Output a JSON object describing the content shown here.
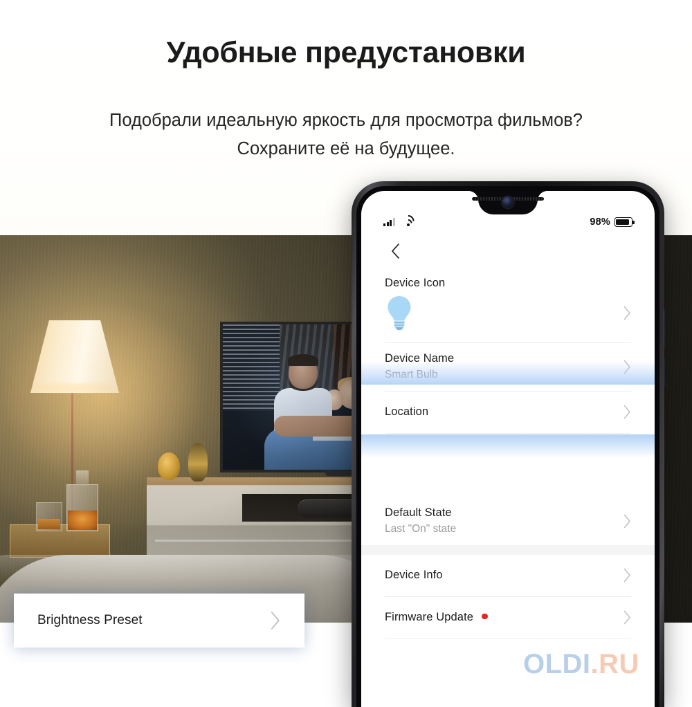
{
  "header": {
    "title": "Удобные предустановки",
    "subtitle": "Подобрали идеальную яркость для просмотра фильмов? Сохраните её на будущее."
  },
  "phone": {
    "status_bar": {
      "signal_icon": "signal-bars-icon",
      "wifi_icon": "wifi-icon",
      "battery_percent": "98%",
      "battery_icon": "battery-icon"
    },
    "nav": {
      "back_icon": "chevron-left-icon"
    },
    "settings_list": [
      {
        "id": "device-icon",
        "label": "Device Icon",
        "sub": "",
        "icon": "light-bulb-icon",
        "chevron": "chevron-right-icon",
        "badge": false
      },
      {
        "id": "device-name",
        "label": "Device Name",
        "sub": "Smart Bulb",
        "icon": "",
        "chevron": "chevron-right-icon",
        "badge": false
      },
      {
        "id": "location",
        "label": "Location",
        "sub": "",
        "icon": "",
        "chevron": "chevron-right-icon",
        "badge": false
      },
      {
        "id": "default-state",
        "label": "Default State",
        "sub": "Last \"On\" state",
        "icon": "",
        "chevron": "chevron-right-icon",
        "badge": false
      },
      {
        "id": "device-info",
        "label": "Device Info",
        "sub": "",
        "icon": "",
        "chevron": "chevron-right-icon",
        "badge": false
      },
      {
        "id": "firmware-update",
        "label": "Firmware Update",
        "sub": "",
        "icon": "",
        "chevron": "chevron-right-icon",
        "badge": true
      }
    ],
    "highlighted_row": {
      "label": "Brightness Preset",
      "chevron": "chevron-right-icon"
    }
  },
  "watermark": {
    "part_a": "OLDI",
    "part_b": ".RU",
    "color_a": "#b8cfe8",
    "color_b": "#f6cbb3"
  },
  "colors": {
    "accent_blue": "#aacdf5",
    "badge_red": "#e8251f",
    "bulb_blue": "#a8d8f5",
    "text_primary": "#1c1c1e",
    "text_secondary": "#9a9a9e"
  }
}
